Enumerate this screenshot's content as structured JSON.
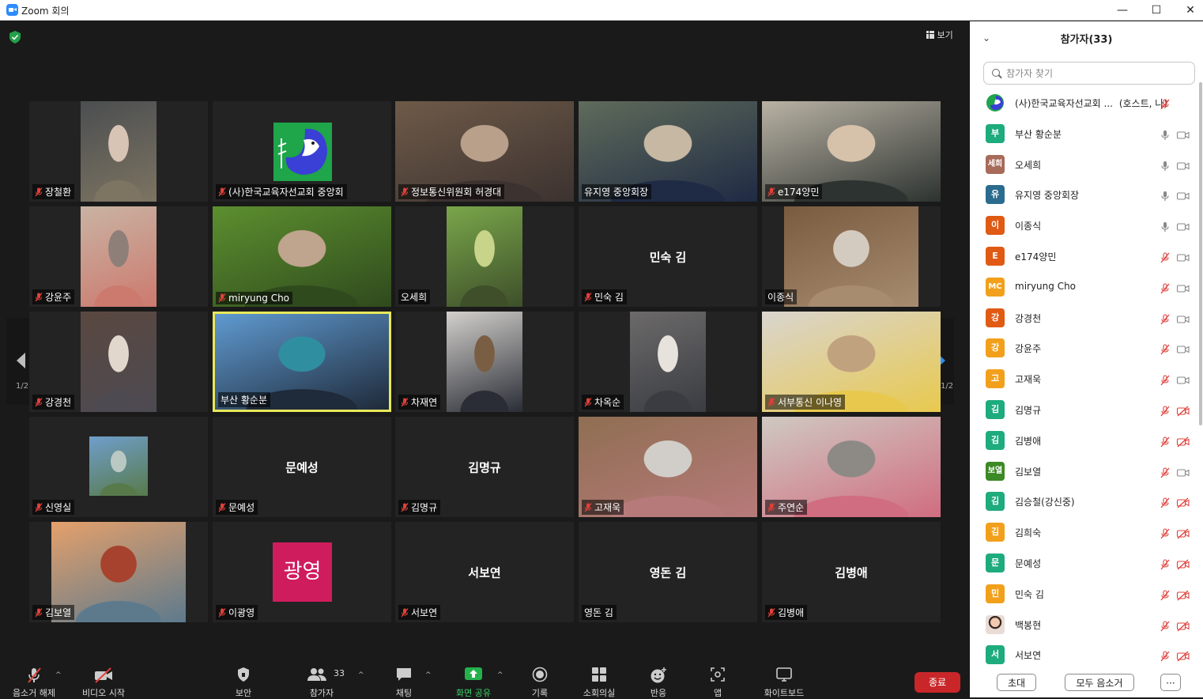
{
  "window": {
    "title": "Zoom 회의",
    "minimize": "—",
    "maximize": "☐",
    "close": "✕"
  },
  "main": {
    "view_label": "보기",
    "page_left": "1/2",
    "page_right": "1/2"
  },
  "tiles": [
    {
      "name": "장철환",
      "muted": true,
      "kind": "video",
      "colors": [
        "#4b4e50",
        "#d8c4b4",
        "#7d7462"
      ]
    },
    {
      "name": "(사)한국교육자선교회 중앙회",
      "muted": true,
      "kind": "logo"
    },
    {
      "name": "정보통신위원회 허경대",
      "muted": true,
      "kind": "video",
      "colors": [
        "#6e5a48",
        "#b9a08a",
        "#3c3230"
      ]
    },
    {
      "name": "유지영 중앙회장",
      "muted": false,
      "kind": "video",
      "colors": [
        "#5f6b5a",
        "#c7b8a3",
        "#1f2a44"
      ]
    },
    {
      "name": "e174양민",
      "muted": true,
      "kind": "video",
      "colors": [
        "#b9b2a4",
        "#d6c2aa",
        "#2d3330"
      ]
    },
    {
      "name": "강윤주",
      "muted": true,
      "kind": "video",
      "colors": [
        "#c9b3a3",
        "#8e7f79",
        "#cc7a6e"
      ]
    },
    {
      "name": "miryung Cho",
      "muted": true,
      "kind": "video",
      "colors": [
        "#5c8f2f",
        "#bfa48e",
        "#2f4a1d"
      ]
    },
    {
      "name": "오세희",
      "muted": false,
      "kind": "video",
      "colors": [
        "#79a64a",
        "#c7d489",
        "#3e4f2a"
      ]
    },
    {
      "name": "민숙 김",
      "muted": true,
      "kind": "name",
      "display": "민숙 김"
    },
    {
      "name": "이종식",
      "muted": false,
      "kind": "video",
      "colors": [
        "#7a5b40",
        "#d4cbc0",
        "#a78c70"
      ]
    },
    {
      "name": "강경천",
      "muted": true,
      "kind": "video",
      "colors": [
        "#5a4840",
        "#e2d7cd",
        "#4d4a52"
      ]
    },
    {
      "name": "부산 황순분",
      "muted": false,
      "kind": "video",
      "speaking": true,
      "colors": [
        "#5f9ad0",
        "#2f8fa0",
        "#1f2a3a"
      ]
    },
    {
      "name": "차재연",
      "muted": true,
      "kind": "video",
      "colors": [
        "#d3d0cc",
        "#7a5e44",
        "#2a2d36"
      ]
    },
    {
      "name": "차옥순",
      "muted": true,
      "kind": "video",
      "colors": [
        "#6c6a6a",
        "#e7e2dc",
        "#3a3c42"
      ]
    },
    {
      "name": "서부통신 이나영",
      "muted": true,
      "kind": "video",
      "colors": [
        "#d9d5cf",
        "#c1a27f",
        "#e8c94e"
      ]
    },
    {
      "name": "신영실",
      "muted": true,
      "kind": "video",
      "colors": [
        "#6f9ecb",
        "#b9c8c2",
        "#587a4b"
      ]
    },
    {
      "name": "문예성",
      "muted": true,
      "kind": "name",
      "display": "문예성"
    },
    {
      "name": "김명규",
      "muted": true,
      "kind": "name",
      "display": "김명규"
    },
    {
      "name": "고재욱",
      "muted": true,
      "kind": "video",
      "colors": [
        "#8f6e52",
        "#d1cec9",
        "#b77a7a"
      ]
    },
    {
      "name": "주연순",
      "muted": true,
      "kind": "video",
      "colors": [
        "#cfc9c2",
        "#8d8a86",
        "#d06d80"
      ]
    },
    {
      "name": "김보열",
      "muted": true,
      "kind": "video",
      "colors": [
        "#e4a06b",
        "#a6422e",
        "#5d7a8d"
      ]
    },
    {
      "name": "이광영",
      "muted": true,
      "kind": "avatar",
      "display": "광영",
      "color": "#cf1c5c"
    },
    {
      "name": "서보연",
      "muted": true,
      "kind": "name",
      "display": "서보연"
    },
    {
      "name": "영돈 김",
      "muted": false,
      "kind": "name",
      "display": "영돈 김"
    },
    {
      "name": "김병애",
      "muted": true,
      "kind": "name",
      "display": "김병애"
    }
  ],
  "toolbar": {
    "mute": "음소거 해제",
    "video": "비디오 시작",
    "security": "보안",
    "participants": "참가자",
    "participants_count": "33",
    "chat": "채팅",
    "share": "화면 공유",
    "record": "기록",
    "breakout": "소회의실",
    "reactions": "반응",
    "apps": "앱",
    "whiteboard": "화이트보드",
    "end": "종료"
  },
  "panel": {
    "title": "참가자(33)",
    "search_placeholder": "참가자 찾기",
    "invite": "초대",
    "mute_all": "모두 음소거",
    "more": "···",
    "participants": [
      {
        "initials": "",
        "name": "(사)한국교육자선교회 ...",
        "suffix": "(호스트, 나)",
        "color": "#ffffff",
        "photo": "logo",
        "mic": "muted",
        "cam": "none"
      },
      {
        "initials": "부",
        "name": "부산 황순분",
        "color": "#1eab7d",
        "mic": "on",
        "cam": "on"
      },
      {
        "initials": "세희",
        "name": "오세희",
        "color": "#a86b5a",
        "mic": "on",
        "cam": "on"
      },
      {
        "initials": "유",
        "name": "유지영 중앙회장",
        "color": "#2b6b8e",
        "mic": "on",
        "cam": "on"
      },
      {
        "initials": "이",
        "name": "이종식",
        "color": "#e05a14",
        "mic": "on",
        "cam": "on"
      },
      {
        "initials": "E",
        "name": "e174양민",
        "color": "#e05a14",
        "mic": "muted",
        "cam": "on"
      },
      {
        "initials": "MC",
        "name": "miryung Cho",
        "color": "#f2a01c",
        "mic": "muted",
        "cam": "on"
      },
      {
        "initials": "강",
        "name": "강경천",
        "color": "#e05a14",
        "mic": "muted",
        "cam": "on"
      },
      {
        "initials": "강",
        "name": "강윤주",
        "color": "#f2a01c",
        "mic": "muted",
        "cam": "on"
      },
      {
        "initials": "고",
        "name": "고재욱",
        "color": "#f2a01c",
        "mic": "muted",
        "cam": "on"
      },
      {
        "initials": "김",
        "name": "김명규",
        "color": "#1eab7d",
        "mic": "muted",
        "cam": "off"
      },
      {
        "initials": "김",
        "name": "김병애",
        "color": "#1eab7d",
        "mic": "muted",
        "cam": "off"
      },
      {
        "initials": "보열",
        "name": "김보열",
        "color": "#3c8a25",
        "mic": "muted",
        "cam": "on"
      },
      {
        "initials": "김",
        "name": "김승철(강신중)",
        "color": "#1eab7d",
        "mic": "muted",
        "cam": "off"
      },
      {
        "initials": "김",
        "name": "김희숙",
        "color": "#f2a01c",
        "mic": "muted",
        "cam": "off"
      },
      {
        "initials": "문",
        "name": "문예성",
        "color": "#1eab7d",
        "mic": "muted",
        "cam": "off"
      },
      {
        "initials": "민",
        "name": "민숙 김",
        "color": "#f2a01c",
        "mic": "muted",
        "cam": "off"
      },
      {
        "initials": "",
        "name": "백봉현",
        "color": "#f3d7c8",
        "photo": "face",
        "mic": "muted",
        "cam": "off"
      },
      {
        "initials": "서",
        "name": "서보연",
        "color": "#1eab7d",
        "mic": "muted",
        "cam": "off"
      }
    ]
  }
}
